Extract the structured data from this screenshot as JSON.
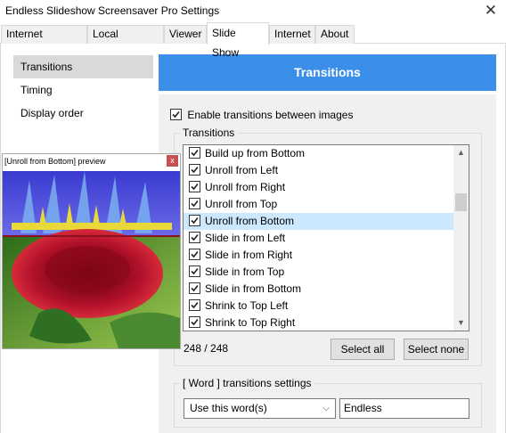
{
  "window": {
    "title": "Endless Slideshow Screensaver Pro Settings",
    "close_glyph": "✕"
  },
  "tabs": [
    {
      "label": "Internet pictures",
      "active": false
    },
    {
      "label": "Local pictures",
      "active": false
    },
    {
      "label": "Viewer",
      "active": false
    },
    {
      "label": "Slide Show",
      "active": true
    },
    {
      "label": "Internet",
      "active": false
    },
    {
      "label": "About",
      "active": false
    }
  ],
  "sidebar": {
    "items": [
      {
        "label": "Transitions",
        "selected": true
      },
      {
        "label": "Timing",
        "selected": false
      },
      {
        "label": "Display order",
        "selected": false
      }
    ]
  },
  "header": {
    "title": "Transitions",
    "color": "#3b8fe8"
  },
  "enable": {
    "label": "Enable transitions between images",
    "checked": true
  },
  "transitions_group": {
    "legend": "Transitions",
    "items": [
      {
        "label": "Build up from Bottom",
        "checked": true,
        "selected": false
      },
      {
        "label": "Unroll from Left",
        "checked": true,
        "selected": false
      },
      {
        "label": "Unroll from Right",
        "checked": true,
        "selected": false
      },
      {
        "label": "Unroll from Top",
        "checked": true,
        "selected": false
      },
      {
        "label": "Unroll from Bottom",
        "checked": true,
        "selected": true
      },
      {
        "label": "Slide in from Left",
        "checked": true,
        "selected": false
      },
      {
        "label": "Slide in from Right",
        "checked": true,
        "selected": false
      },
      {
        "label": "Slide in from Top",
        "checked": true,
        "selected": false
      },
      {
        "label": "Slide in from Bottom",
        "checked": true,
        "selected": false
      },
      {
        "label": "Shrink to Top Left",
        "checked": true,
        "selected": false
      },
      {
        "label": "Shrink to Top Right",
        "checked": true,
        "selected": false
      }
    ],
    "count": "248 / 248",
    "select_all_label": "Select all",
    "select_none_label": "Select none"
  },
  "word_group": {
    "legend": "[ Word ] transitions settings",
    "select_value": "Use this word(s)",
    "word_value": "Endless"
  },
  "preview": {
    "title": "[Unroll from Bottom] preview",
    "close_glyph": "x"
  },
  "icons": {
    "checkbox": "check-icon",
    "scroll_up": "chevron-up-icon",
    "scroll_down": "chevron-down-icon",
    "dropdown": "chevron-down-icon"
  }
}
